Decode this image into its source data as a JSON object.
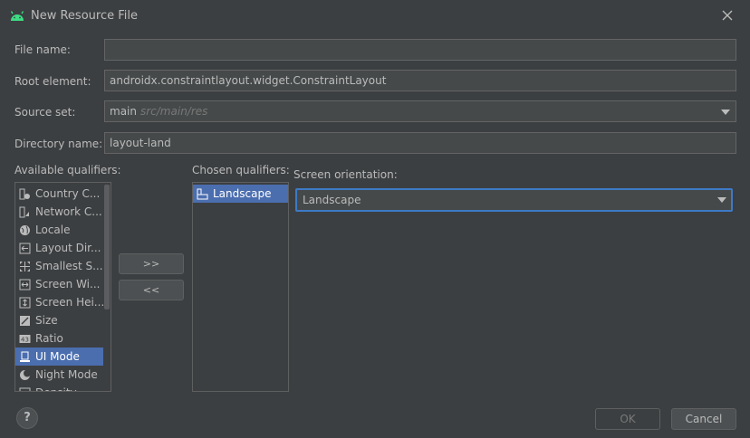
{
  "window": {
    "title": "New Resource File"
  },
  "form": {
    "file_name_label": "File name:",
    "file_name_value": "",
    "root_element_label": "Root element:",
    "root_element_value": "androidx.constraintlayout.widget.ConstraintLayout",
    "source_set_label": "Source set:",
    "source_set_value": "main",
    "source_set_hint": "src/main/res",
    "directory_label": "Directory name:",
    "directory_value": "layout-land"
  },
  "qualifiers": {
    "available_label": "Available qualifiers:",
    "chosen_label": "Chosen qualifiers:",
    "available": [
      {
        "label": "Country C...",
        "icon": "country-code-icon"
      },
      {
        "label": "Network C...",
        "icon": "network-code-icon"
      },
      {
        "label": "Locale",
        "icon": "globe-icon"
      },
      {
        "label": "Layout Dir...",
        "icon": "layout-direction-icon"
      },
      {
        "label": "Smallest S...",
        "icon": "smallest-screen-icon"
      },
      {
        "label": "Screen Wi...",
        "icon": "screen-width-icon"
      },
      {
        "label": "Screen Hei...",
        "icon": "screen-height-icon"
      },
      {
        "label": "Size",
        "icon": "size-icon"
      },
      {
        "label": "Ratio",
        "icon": "ratio-icon"
      },
      {
        "label": "UI Mode",
        "icon": "ui-mode-icon"
      },
      {
        "label": "Night Mode",
        "icon": "night-mode-icon"
      },
      {
        "label": "Density",
        "icon": "density-icon"
      }
    ],
    "chosen": [
      {
        "label": "Landscape",
        "icon": "landscape-icon"
      }
    ],
    "add_button": ">>",
    "remove_button": "<<"
  },
  "detail": {
    "orientation_label": "Screen orientation:",
    "orientation_value": "Landscape"
  },
  "footer": {
    "ok_label": "OK",
    "cancel_label": "Cancel",
    "help_label": "?"
  },
  "colors": {
    "background": "#3c3f41",
    "selection": "#4b6eaf",
    "focus": "#3d7ac7"
  }
}
